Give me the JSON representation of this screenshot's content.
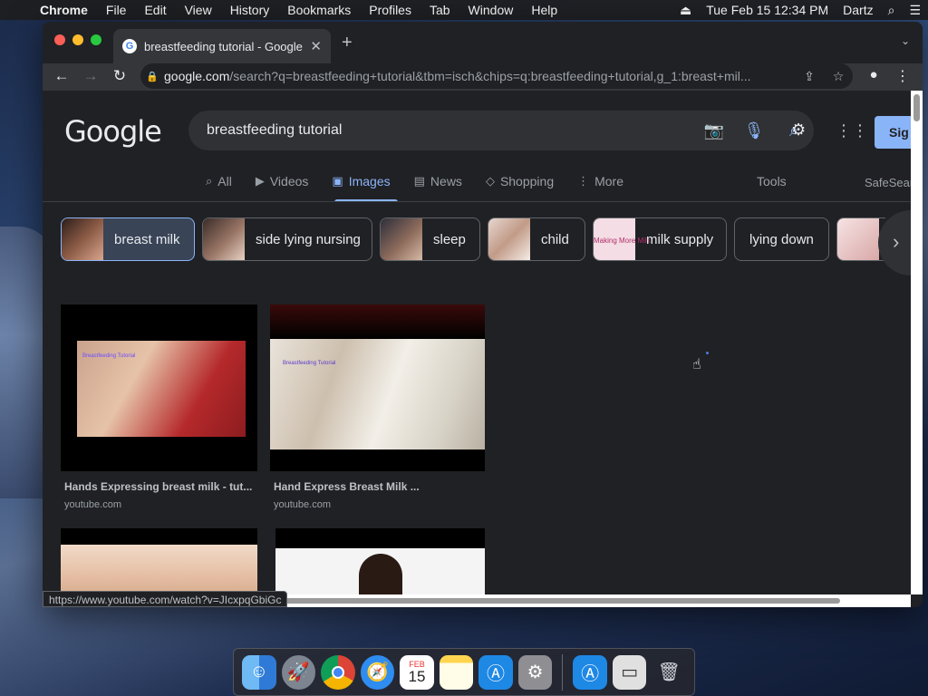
{
  "menubar": {
    "apple": "",
    "app": "Chrome",
    "items": [
      "File",
      "Edit",
      "View",
      "History",
      "Bookmarks",
      "Profiles",
      "Tab",
      "Window",
      "Help"
    ],
    "datetime": "Tue Feb 15  12:34 PM",
    "user": "Dartz"
  },
  "browser": {
    "tab_title": "breastfeeding tutorial - Google",
    "url_host": "google.com",
    "url_path": "/search?q=breastfeeding+tutorial&tbm=isch&chips=q:breastfeeding+tutorial,g_1:breast+mil..."
  },
  "google": {
    "logo": "Google",
    "query": "breastfeeding tutorial",
    "signin": "Sig",
    "nav": [
      {
        "label": "All",
        "icon": "search-icon"
      },
      {
        "label": "Videos",
        "icon": "video-icon"
      },
      {
        "label": "Images",
        "icon": "image-icon"
      },
      {
        "label": "News",
        "icon": "news-icon"
      },
      {
        "label": "Shopping",
        "icon": "tag-icon"
      },
      {
        "label": "More",
        "icon": "more-vert-icon"
      }
    ],
    "tools": "Tools",
    "safesearch": "SafeSear",
    "chips": [
      {
        "label": "breast milk",
        "selected": true,
        "color": "#6b4a3e"
      },
      {
        "label": "side lying nursing",
        "color": "#5c4a40"
      },
      {
        "label": "sleep",
        "color": "#4d3f3a"
      },
      {
        "label": "child",
        "color": "#c9a99a"
      },
      {
        "label": "milk supply",
        "thumb_text": "Making More Milk",
        "color": "#f3d6df"
      },
      {
        "label": "lying down",
        "color": null
      },
      {
        "label": "",
        "color": "#e6c7c7"
      }
    ],
    "results": [
      {
        "caption": "Hands Expressing breast milk - tut...",
        "source": "youtube.com",
        "overlay": "Breastfeeding Tutorial"
      },
      {
        "caption": "Hand Express Breast Milk ...",
        "source": "youtube.com",
        "overlay": "Breastfeeding Tutorial"
      },
      {
        "caption": "",
        "source": ""
      },
      {
        "caption": "",
        "source": ""
      }
    ]
  },
  "status_url": "https://www.youtube.com/watch?v=JIcxpqGbiGc",
  "dock": {
    "calendar_month": "FEB",
    "calendar_day": "15"
  }
}
